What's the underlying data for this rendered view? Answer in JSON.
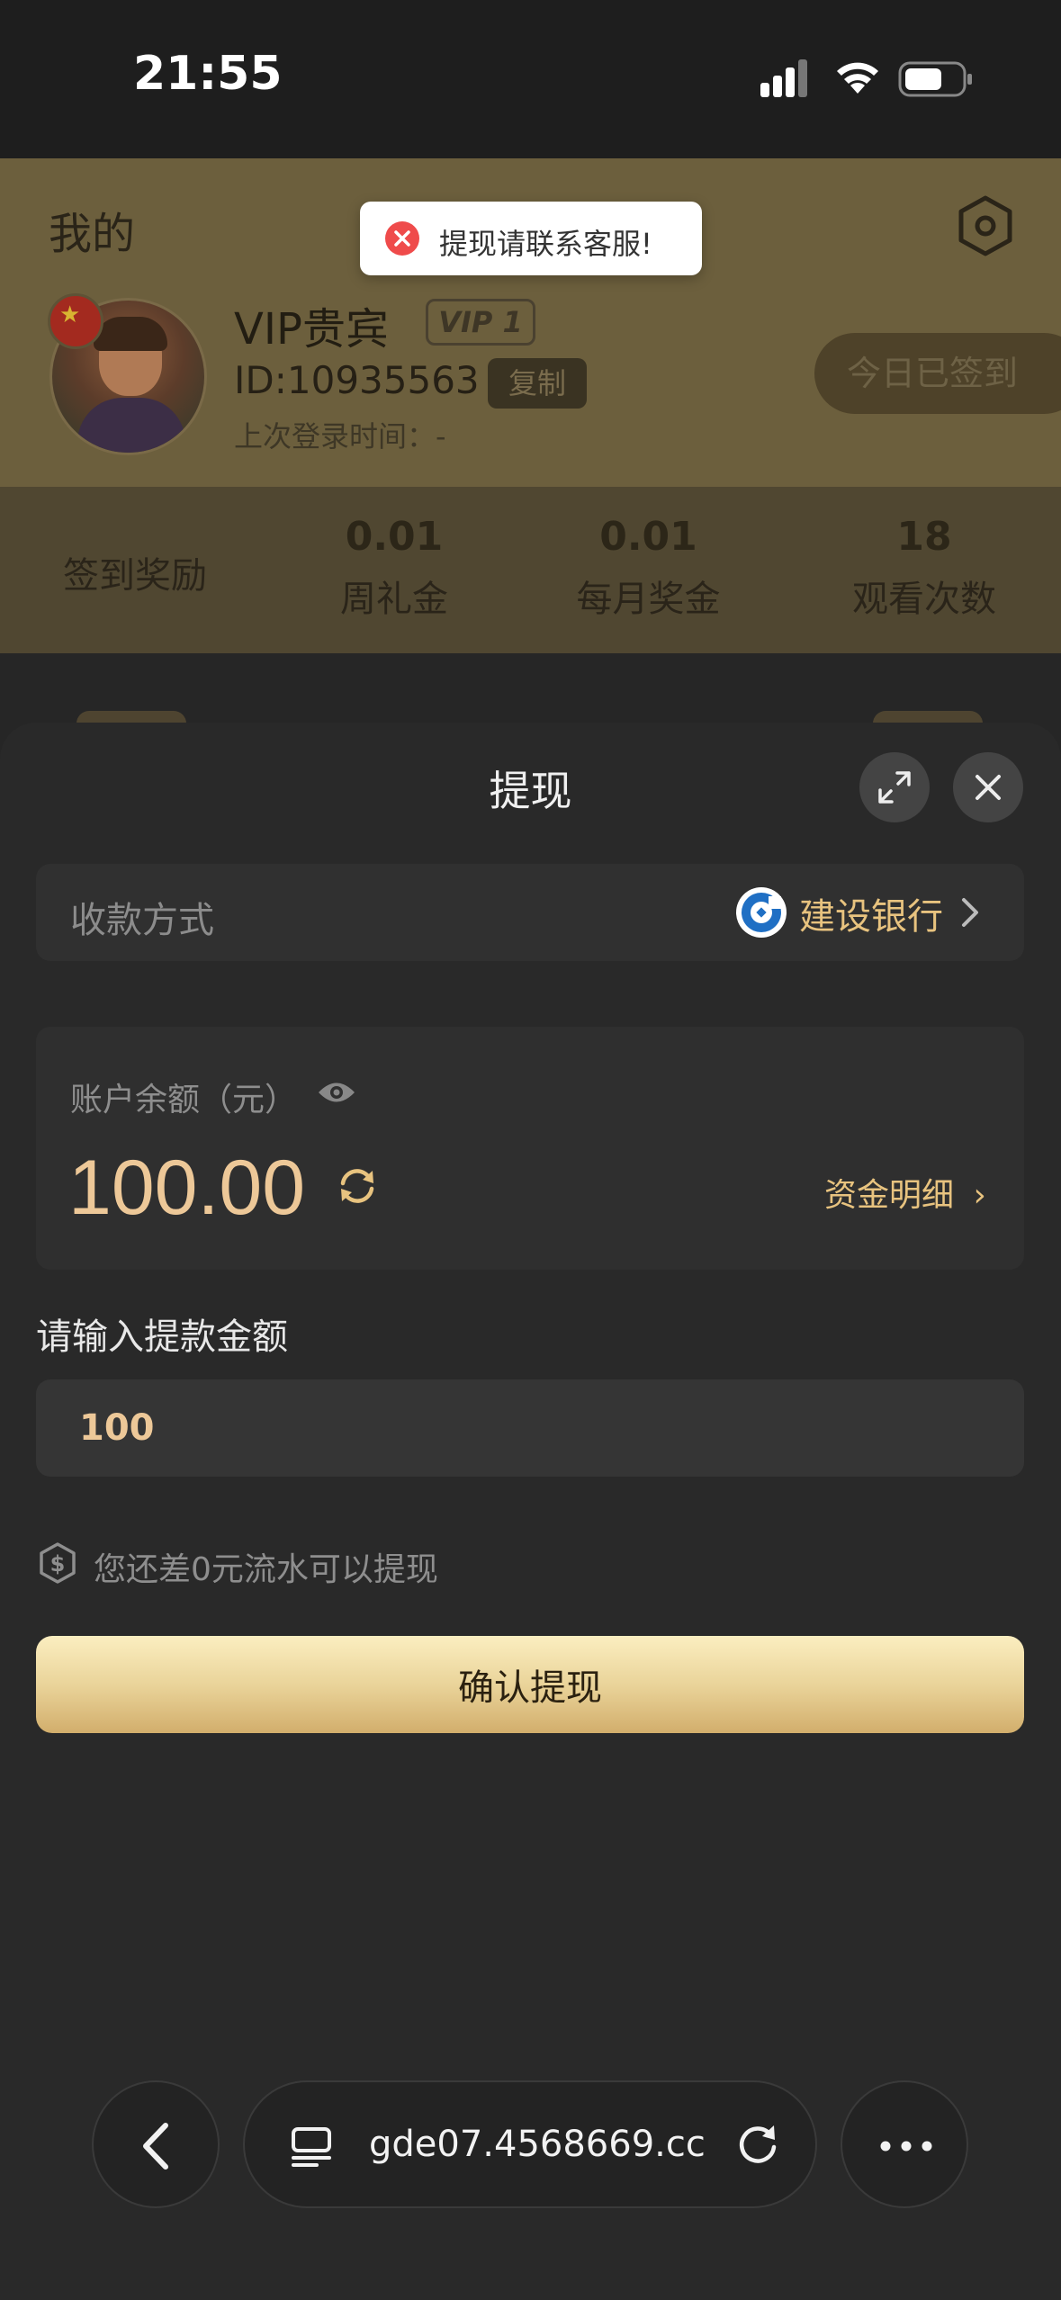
{
  "status_bar": {
    "time": "21:55"
  },
  "profile": {
    "title": "我的",
    "name": "VIP贵宾",
    "vip_badge": "VIP 1",
    "user_id": "ID:10935563",
    "copy_label": "复制",
    "last_login": "上次登录时间：-",
    "checkin_label": "今日已签到"
  },
  "stats": {
    "signin_reward_label": "签到奖励",
    "items": [
      {
        "value": "0.01",
        "label": "周礼金"
      },
      {
        "value": "0.01",
        "label": "每月奖金"
      },
      {
        "value": "18",
        "label": "观看次数"
      }
    ]
  },
  "toast": {
    "message": "提现请联系客服!",
    "icon": "error-icon"
  },
  "sheet": {
    "title": "提现",
    "method_label": "收款方式",
    "bank_name": "建设银行",
    "balance_label": "账户余额（元）",
    "balance_amount": "100.00",
    "fund_detail_label": "资金明细",
    "input_label": "请输入提款金额",
    "amount_value": "100",
    "hint": "您还差0元流水可以提现",
    "confirm_label": "确认提现"
  },
  "browser": {
    "url": "gde07.4568669.cc"
  },
  "colors": {
    "accent_gold": "#e8c37f",
    "sheet_bg": "#292929",
    "toast_error": "#ef4b4b",
    "header_gold_dimmed": "#6c5f3d"
  }
}
